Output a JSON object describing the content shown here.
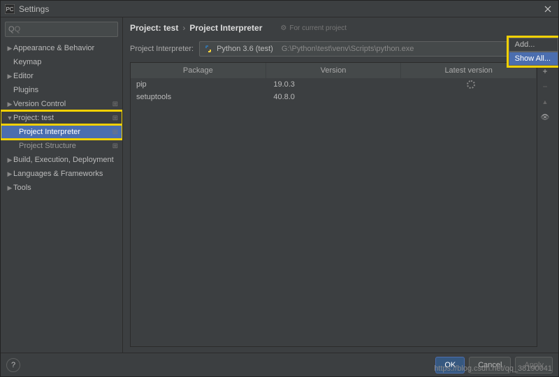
{
  "titlebar": {
    "title": "Settings"
  },
  "search": {
    "placeholder": "Q"
  },
  "sidebar": {
    "items": [
      {
        "label": "Appearance & Behavior",
        "arrow": "▶"
      },
      {
        "label": "Keymap",
        "arrow": ""
      },
      {
        "label": "Editor",
        "arrow": "▶"
      },
      {
        "label": "Plugins",
        "arrow": ""
      },
      {
        "label": "Version Control",
        "arrow": "▶",
        "gear": true
      },
      {
        "label": "Project: test",
        "arrow": "▼",
        "gear": true,
        "highlight": true
      },
      {
        "label": "Project Interpreter",
        "arrow": "",
        "sub": true,
        "selected": true,
        "gear": true,
        "highlight": true
      },
      {
        "label": "Project Structure",
        "arrow": "",
        "sub": true,
        "gear": true
      },
      {
        "label": "Build, Execution, Deployment",
        "arrow": "▶"
      },
      {
        "label": "Languages & Frameworks",
        "arrow": "▶"
      },
      {
        "label": "Tools",
        "arrow": "▶"
      }
    ]
  },
  "breadcrumb": {
    "root": "Project: test",
    "sep": "›",
    "current": "Project Interpreter",
    "hint": "For current project"
  },
  "interpreter": {
    "label": "Project Interpreter:",
    "name": "Python 3.6 (test)",
    "path": "G:\\Python\\test\\venv\\Scripts\\python.exe"
  },
  "dropdown": {
    "items": [
      {
        "label": "Add...",
        "selected": false
      },
      {
        "label": "Show All...",
        "selected": true
      }
    ]
  },
  "table": {
    "columns": [
      "Package",
      "Version",
      "Latest version"
    ],
    "rows": [
      {
        "name": "pip",
        "version": "19.0.3",
        "loading": true
      },
      {
        "name": "setuptools",
        "version": "40.8.0",
        "loading": false
      }
    ]
  },
  "tool_icons": {
    "plus": "+",
    "minus": "−",
    "up": "▲",
    "eye": "👁"
  },
  "footer": {
    "help": "?",
    "ok": "OK",
    "cancel": "Cancel",
    "apply": "Apply"
  },
  "watermark": "https://blog.csdn.net/qq_38190041"
}
